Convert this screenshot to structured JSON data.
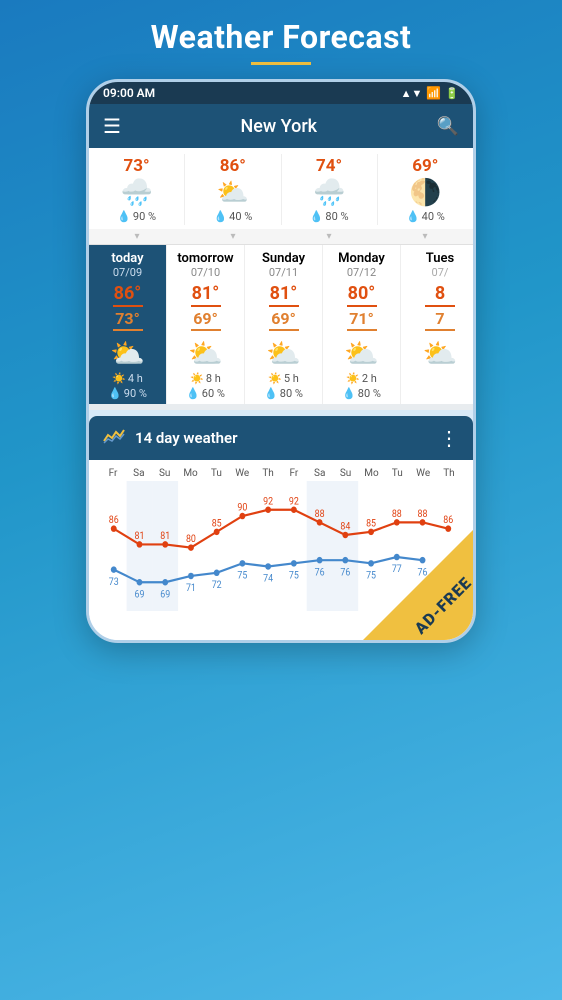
{
  "page": {
    "title": "Weather Forecast",
    "title_underline_color": "#f0c040"
  },
  "status_bar": {
    "time": "09:00 AM",
    "signal": "▲▼",
    "wifi": "▲",
    "battery": "▮"
  },
  "toolbar": {
    "city": "New York",
    "menu_label": "☰",
    "search_label": "🔍"
  },
  "hourly": [
    {
      "temp": "73°",
      "icon": "🌧️",
      "rain": "90 %"
    },
    {
      "temp": "86°",
      "icon": "⛅",
      "rain": "40 %"
    },
    {
      "temp": "74°",
      "icon": "🌧️",
      "rain": "80 %"
    },
    {
      "temp": "69°",
      "icon": "🌗",
      "rain": "40 %"
    }
  ],
  "daily": [
    {
      "label": "today",
      "date": "07/09",
      "high": "86°",
      "low": "73°",
      "icon": "⛅",
      "sun": "4 h",
      "rain": "90 %",
      "is_today": true
    },
    {
      "label": "tomorrow",
      "date": "07/10",
      "high": "81°",
      "low": "69°",
      "icon": "⛅",
      "sun": "8 h",
      "rain": "60 %",
      "is_today": false
    },
    {
      "label": "Sunday",
      "date": "07/11",
      "high": "81°",
      "low": "69°",
      "icon": "⛅",
      "sun": "5 h",
      "rain": "80 %",
      "is_today": false
    },
    {
      "label": "Monday",
      "date": "07/12",
      "high": "80°",
      "low": "71°",
      "icon": "⛅",
      "sun": "2 h",
      "rain": "80 %",
      "is_today": false
    },
    {
      "label": "Tues",
      "date": "07/",
      "high": "8",
      "low": "7",
      "icon": "⛅",
      "sun": "",
      "rain": "",
      "is_today": false,
      "partial": true
    }
  ],
  "fourteen_day": {
    "title": "14 day weather",
    "icon": "📈",
    "days": [
      "Fr",
      "Sa",
      "Su",
      "Mo",
      "Tu",
      "We",
      "Th",
      "Fr",
      "Sa",
      "Su",
      "Mo",
      "Tu",
      "We",
      "Th"
    ],
    "highs": [
      86,
      81,
      81,
      80,
      85,
      90,
      92,
      92,
      88,
      84,
      85,
      88,
      88,
      86
    ],
    "lows": [
      73,
      69,
      69,
      71,
      72,
      75,
      74,
      75,
      76,
      76,
      75,
      77,
      76,
      null
    ]
  },
  "ad_free": {
    "text": "AD-\nFREE"
  }
}
